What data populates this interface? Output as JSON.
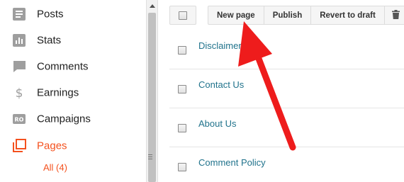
{
  "sidebar": {
    "items": [
      {
        "label": "Posts",
        "icon": "posts-icon"
      },
      {
        "label": "Stats",
        "icon": "stats-icon"
      },
      {
        "label": "Comments",
        "icon": "comments-icon"
      },
      {
        "label": "Earnings",
        "icon": "dollar-icon"
      },
      {
        "label": "Campaigns",
        "icon": "campaigns-icon"
      },
      {
        "label": "Pages",
        "icon": "pages-icon",
        "active": true
      }
    ],
    "sub_item": "All (4)"
  },
  "toolbar": {
    "new_page_label": "New page",
    "publish_label": "Publish",
    "revert_label": "Revert to draft",
    "delete_icon": "trash-icon"
  },
  "pages": [
    {
      "title": "Disclaimer"
    },
    {
      "title": "Contact Us"
    },
    {
      "title": "About Us"
    },
    {
      "title": "Comment Policy"
    }
  ],
  "colors": {
    "accent": "#f4511e",
    "link": "#21738c",
    "icon_grey": "#9e9e9e",
    "annotation_arrow": "#ee1c1c"
  }
}
